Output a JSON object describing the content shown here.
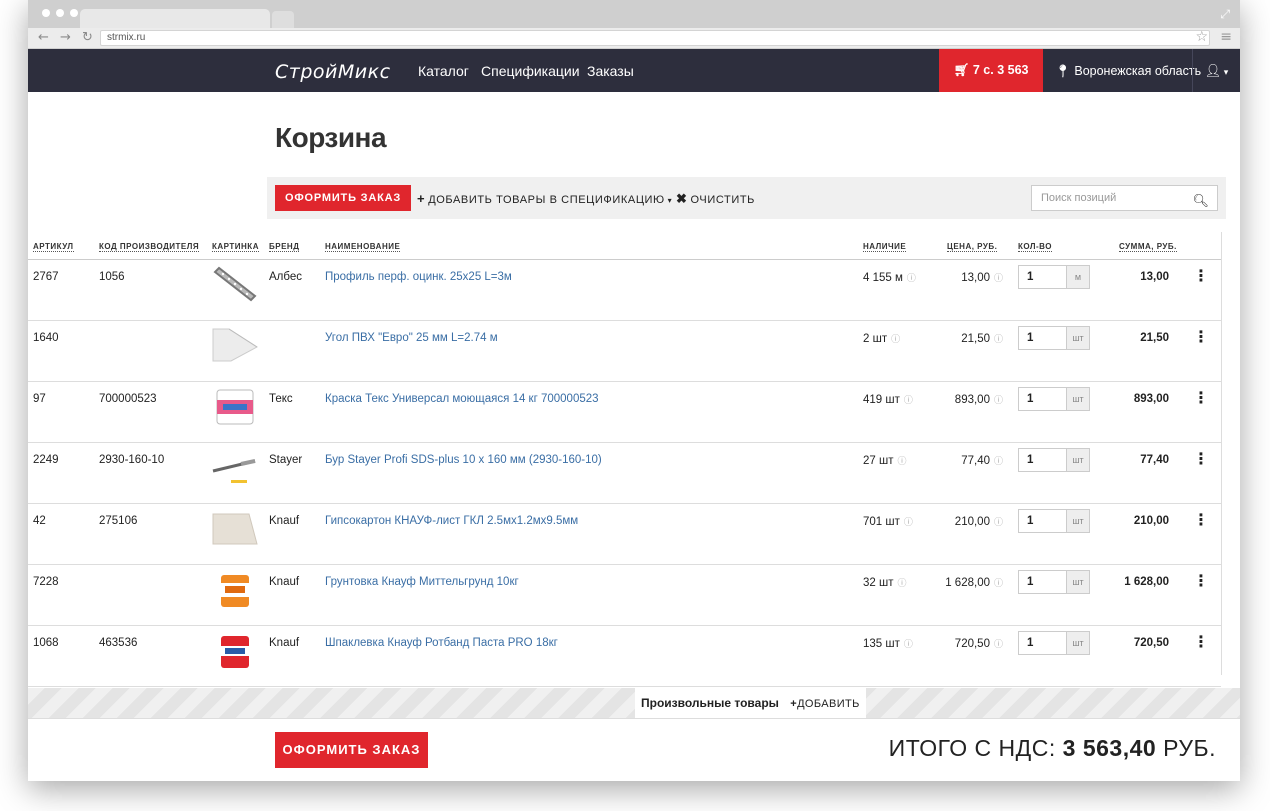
{
  "browser": {
    "url": "strmix.ru"
  },
  "header": {
    "logo": "СтройМикс",
    "nav": [
      "Каталог",
      "Спецификации",
      "Заказы"
    ],
    "cart": "7 с. 3 563 руб.",
    "region": "Воронежская область"
  },
  "page": {
    "title": "Корзина"
  },
  "toolbar": {
    "order_label": "ОФОРМИТЬ ЗАКАЗ",
    "add_spec_label": "ДОБАВИТЬ ТОВАРЫ В СПЕЦИФИКАЦИЮ",
    "clear_label": "ОЧИСТИТЬ",
    "search_placeholder": "Поиск позиций"
  },
  "table": {
    "columns": [
      "АРТИКУЛ",
      "КОД ПРОИЗВОДИТЕЛЯ",
      "КАРТИНКА",
      "БРЕНД",
      "НАИМЕНОВАНИЕ",
      "НАЛИЧИЕ",
      "ЦЕНА, РУБ.",
      "КОЛ-ВО",
      "СУММА, РУБ."
    ],
    "rows": [
      {
        "article": "2767",
        "code": "1056",
        "brand": "Албес",
        "name": "Профиль перф. оцинк. 25х25 L=3м",
        "stock": "4 155 м",
        "price": "13,00",
        "qty": "1",
        "unit": "м",
        "sum": "13,00",
        "image": "metal-profile"
      },
      {
        "article": "1640",
        "code": "",
        "brand": "",
        "name": "Угол ПВХ \"Евро\" 25 мм L=2.74 м",
        "stock": "2 шт",
        "price": "21,50",
        "qty": "1",
        "unit": "шт",
        "sum": "21,50",
        "image": "pvc-corner"
      },
      {
        "article": "97",
        "code": "700000523",
        "brand": "Текс",
        "name": "Краска Текс Универсал моющаяся 14 кг 700000523",
        "stock": "419 шт",
        "price": "893,00",
        "qty": "1",
        "unit": "шт",
        "sum": "893,00",
        "image": "paint-bucket"
      },
      {
        "article": "2249",
        "code": "2930-160-10",
        "brand": "Stayer",
        "name": "Бур Stayer Profi SDS-plus 10 х 160 мм (2930-160-10)",
        "stock": "27 шт",
        "price": "77,40",
        "qty": "1",
        "unit": "шт",
        "sum": "77,40",
        "image": "drill-bit"
      },
      {
        "article": "42",
        "code": "275106",
        "brand": "Knauf",
        "name": "Гипсокартон КНАУФ-лист ГКЛ 2.5мх1.2мх9.5мм",
        "stock": "701 шт",
        "price": "210,00",
        "qty": "1",
        "unit": "шт",
        "sum": "210,00",
        "image": "drywall-sheet"
      },
      {
        "article": "7228",
        "code": "",
        "brand": "Knauf",
        "name": "Грунтовка Кнауф Миттельгрунд 10кг",
        "stock": "32 шт",
        "price": "1 628,00",
        "qty": "1",
        "unit": "шт",
        "sum": "1 628,00",
        "image": "primer-bucket"
      },
      {
        "article": "1068",
        "code": "463536",
        "brand": "Knauf",
        "name": "Шпаклевка Кнауф Ротбанд Паста PRO 18кг",
        "stock": "135 шт",
        "price": "720,50",
        "qty": "1",
        "unit": "шт",
        "sum": "720,50",
        "image": "putty-bucket"
      }
    ]
  },
  "custom": {
    "label": "Произвольные товары",
    "add_label": "ДОБАВИТЬ"
  },
  "footer": {
    "order_label": "ОФОРМИТЬ ЗАКАЗ",
    "total_prefix": "ИТОГО С НДС:",
    "total_value": "3 563,40",
    "total_currency": "РУБ."
  },
  "colors": {
    "header_bg": "#2d2e3d",
    "accent": "#e0262d",
    "link": "#3a6ea5"
  }
}
